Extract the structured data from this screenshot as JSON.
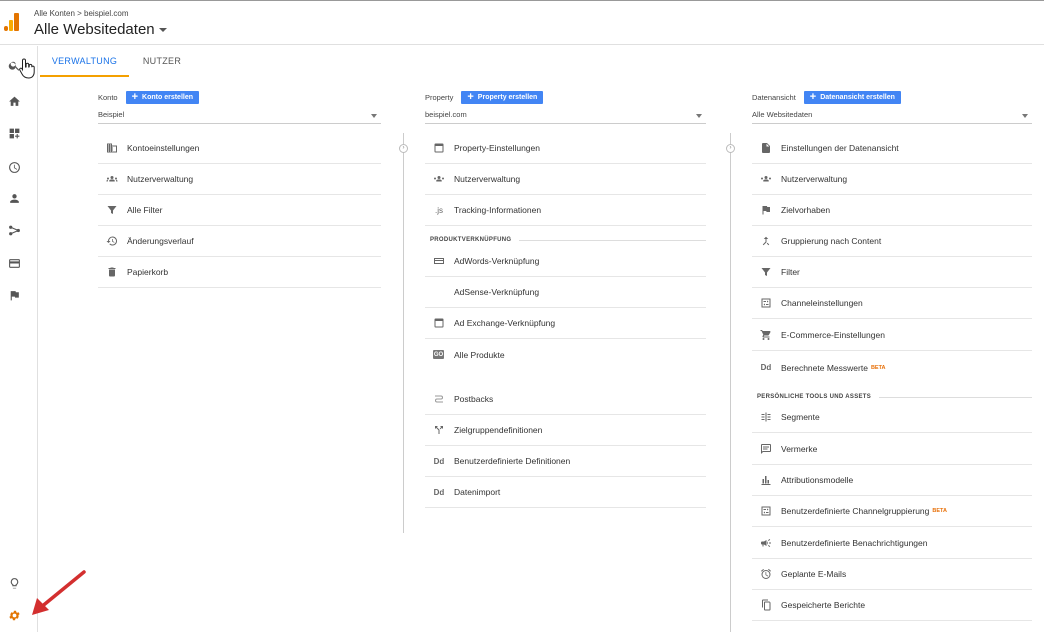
{
  "header": {
    "breadcrumb": "Alle Konten > beispiel.com",
    "title": "Alle Websitedaten"
  },
  "tabs": [
    {
      "label": "VERWALTUNG",
      "active": true
    },
    {
      "label": "NUTZER",
      "active": false
    }
  ],
  "sidebar": {
    "icons": [
      "search-icon",
      "home-icon",
      "dashboard-customize-icon",
      "clock-icon",
      "person-icon",
      "share-icon",
      "card-icon",
      "flag-icon",
      "lightbulb-icon",
      "gear-icon"
    ]
  },
  "account": {
    "label": "Konto",
    "create_button": "Konto erstellen",
    "selected": "Beispiel",
    "items": [
      {
        "label": "Kontoeinstellungen",
        "icon": "building-icon"
      },
      {
        "label": "Nutzerverwaltung",
        "icon": "people-icon"
      },
      {
        "label": "Alle Filter",
        "icon": "filter-icon"
      },
      {
        "label": "Änderungsverlauf",
        "icon": "history-icon"
      },
      {
        "label": "Papierkorb",
        "icon": "trash-icon"
      }
    ]
  },
  "property": {
    "label": "Property",
    "create_button": "Property erstellen",
    "selected": "beispiel.com",
    "items": [
      {
        "label": "Property-Einstellungen",
        "icon": "window-icon"
      },
      {
        "label": "Nutzerverwaltung",
        "icon": "people-icon"
      },
      {
        "label": "Tracking-Informationen",
        "icon": "js-icon",
        "glyph": ".js"
      }
    ],
    "section_links": "PRODUKTVERKNÜPFUNG",
    "link_items": [
      {
        "label": "AdWords-Verknüpfung",
        "icon": "adwords-icon"
      },
      {
        "label": "AdSense-Verknüpfung",
        "icon": "adsense-icon"
      },
      {
        "label": "Ad Exchange-Verknüpfung",
        "icon": "window-icon"
      },
      {
        "label": "Alle Produkte",
        "icon": "go-icon",
        "glyph": "GO"
      }
    ],
    "other_items": [
      {
        "label": "Postbacks",
        "icon": "postback-icon"
      },
      {
        "label": "Zielgruppendefinitionen",
        "icon": "fork-icon"
      },
      {
        "label": "Benutzerdefinierte Definitionen",
        "icon": "dd-icon",
        "glyph": "Dd"
      },
      {
        "label": "Datenimport",
        "icon": "dd-icon",
        "glyph": "Dd"
      }
    ]
  },
  "view": {
    "label": "Datenansicht",
    "create_button": "Datenansicht erstellen",
    "selected": "Alle Websitedaten",
    "items": [
      {
        "label": "Einstellungen der Datenansicht",
        "icon": "document-icon"
      },
      {
        "label": "Nutzerverwaltung",
        "icon": "people-icon"
      },
      {
        "label": "Zielvorhaben",
        "icon": "flag-icon"
      },
      {
        "label": "Gruppierung nach Content",
        "icon": "merge-icon"
      },
      {
        "label": "Filter",
        "icon": "filter-icon"
      },
      {
        "label": "Channeleinstellungen",
        "icon": "channel-icon"
      },
      {
        "label": "E-Commerce-Einstellungen",
        "icon": "cart-icon"
      },
      {
        "label": "Berechnete Messwerte",
        "icon": "dd-icon",
        "glyph": "Dd",
        "badge": "BETA"
      }
    ],
    "section_tools": "PERSÖNLICHE TOOLS UND ASSETS",
    "tool_items": [
      {
        "label": "Segmente",
        "icon": "segments-icon"
      },
      {
        "label": "Vermerke",
        "icon": "comment-icon"
      },
      {
        "label": "Attributionsmodelle",
        "icon": "bar-chart-icon"
      },
      {
        "label": "Benutzerdefinierte Channelgruppierung",
        "icon": "channel-icon",
        "badge": "BETA"
      },
      {
        "label": "Benutzerdefinierte Benachrichtigungen",
        "icon": "megaphone-icon"
      },
      {
        "label": "Geplante E-Mails",
        "icon": "alarm-icon"
      },
      {
        "label": "Gespeicherte Berichte",
        "icon": "saved-report-icon"
      }
    ]
  },
  "colors": {
    "accent_blue": "#4285f4",
    "tab_active_text": "#1a73e8",
    "tab_underline": "#f4a000",
    "settings_gear": "#e37400",
    "annotation_arrow": "#d32f2f",
    "beta": "#e8710a"
  }
}
